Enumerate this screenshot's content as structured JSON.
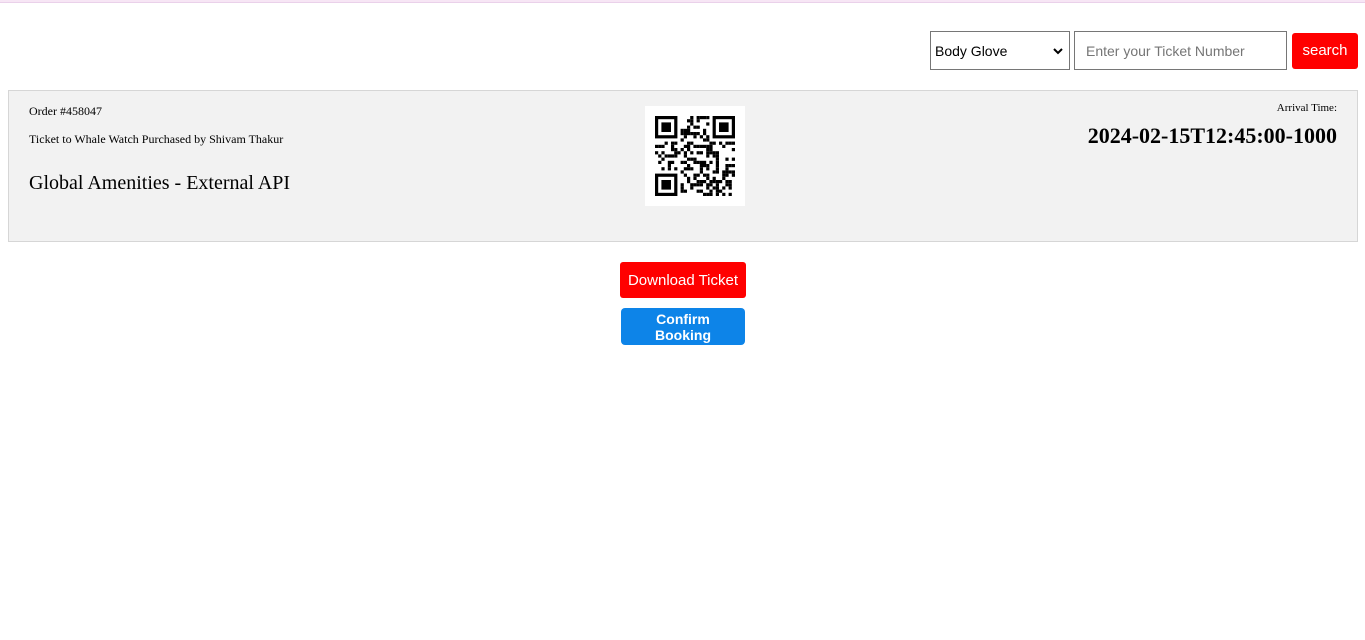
{
  "search": {
    "provider_selected": "Body Glove",
    "ticket_placeholder": "Enter your Ticket Number",
    "ticket_value": "",
    "button_label": "search"
  },
  "ticket": {
    "order_label": "Order #458047",
    "purchase_line": "Ticket to Whale Watch Purchased by Shivam Thakur",
    "amenity_name": "Global Amenities - External API",
    "qr_icon": "qr-code",
    "arrival_label": "Arrival Time:",
    "arrival_value": "2024-02-15T12:45:00-1000"
  },
  "actions": {
    "download_label": "Download Ticket",
    "confirm_label": "Confirm Booking"
  },
  "colors": {
    "primary_red": "#ff0000",
    "confirm_blue": "#0d84e8",
    "card_background": "#f2f2f2"
  }
}
